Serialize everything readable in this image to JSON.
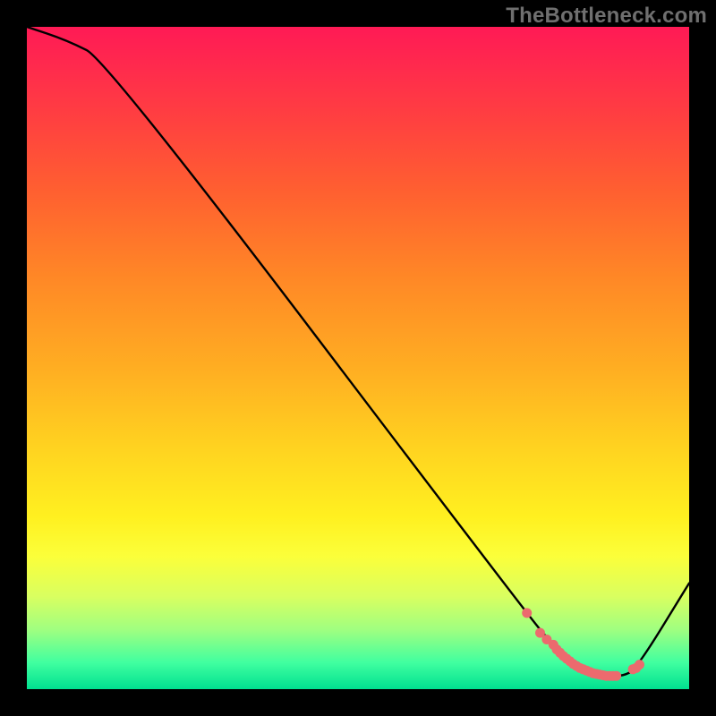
{
  "watermark": "TheBottleneck.com",
  "chart_data": {
    "type": "line",
    "title": "",
    "xlabel": "",
    "ylabel": "",
    "xlim": [
      0,
      100
    ],
    "ylim": [
      0,
      100
    ],
    "series": [
      {
        "name": "curve",
        "x": [
          0,
          6,
          12,
          75,
          80,
          84,
          88,
          90,
          92,
          100
        ],
        "values": [
          100,
          98,
          95,
          12,
          6,
          3,
          2,
          2,
          3,
          16
        ]
      }
    ],
    "markers": {
      "name": "dots",
      "color": "#ec6a6e",
      "x": [
        75.5,
        77.5,
        78.5,
        79.5,
        80.0,
        80.5,
        81.0,
        81.5,
        82.0,
        82.5,
        83.0,
        83.5,
        84.0,
        84.5,
        85.0,
        85.5,
        86.0,
        86.5,
        87.0,
        87.5,
        88.0,
        88.5,
        89.0,
        91.5,
        92.0,
        92.5
      ],
      "values": [
        11.5,
        8.5,
        7.5,
        6.7,
        6.0,
        5.5,
        5.0,
        4.6,
        4.2,
        3.8,
        3.5,
        3.2,
        3.0,
        2.8,
        2.6,
        2.4,
        2.3,
        2.2,
        2.1,
        2.0,
        2.0,
        2.0,
        2.0,
        3.0,
        3.2,
        3.7
      ]
    }
  }
}
